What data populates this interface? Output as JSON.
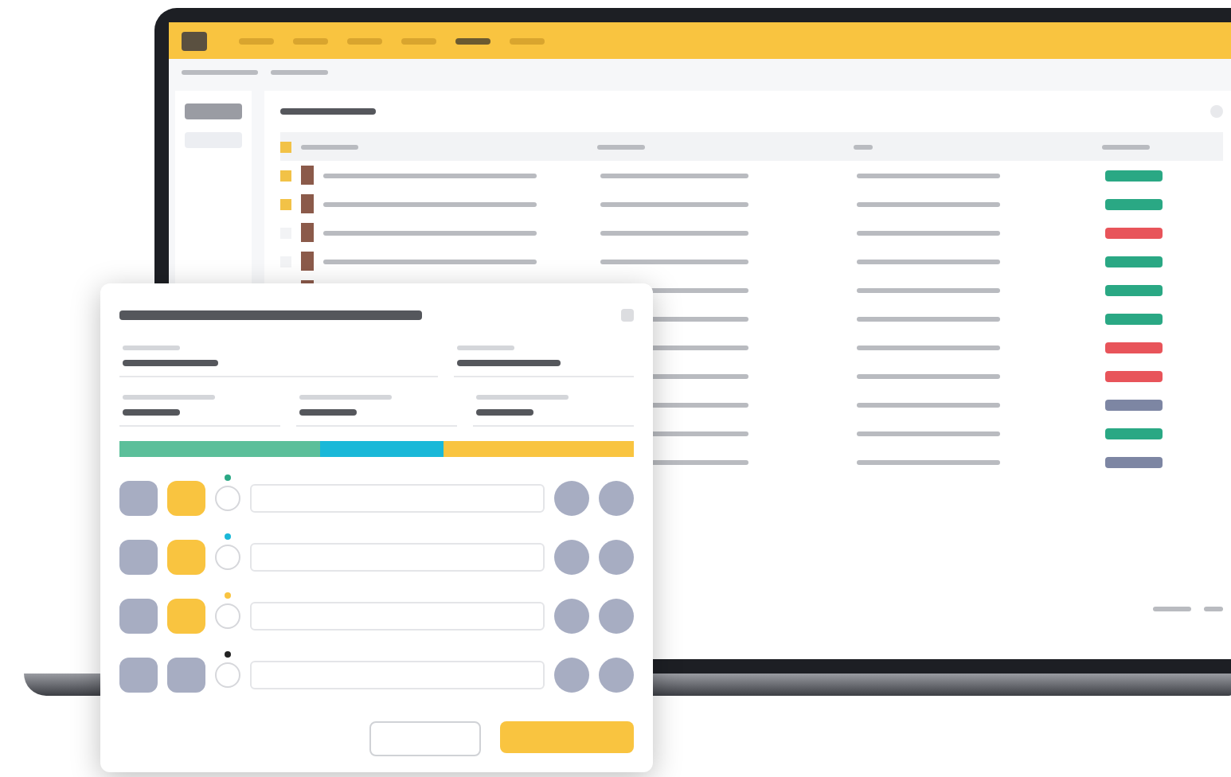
{
  "app": {
    "nav": [
      {
        "selected": false
      },
      {
        "selected": false
      },
      {
        "selected": false
      },
      {
        "selected": false
      },
      {
        "selected": true
      },
      {
        "selected": false
      }
    ],
    "sidebar": [
      {
        "selected": true
      },
      {
        "selected": false
      }
    ],
    "table": {
      "rows": [
        {
          "flagged": true,
          "color": "#2aa884"
        },
        {
          "flagged": true,
          "color": "#2aa884"
        },
        {
          "flagged": false,
          "color": "#e8545a"
        },
        {
          "flagged": false,
          "color": "#2aa884"
        },
        {
          "color": "#2aa884"
        },
        {
          "color": "#2aa884"
        },
        {
          "color": "#e8545a"
        },
        {
          "color": "#e8545a"
        },
        {
          "color": "#7d86a3"
        },
        {
          "color": "#2aa884"
        },
        {
          "color": "#7d86a3"
        }
      ]
    }
  },
  "dialog": {
    "rows": [
      {
        "active": true,
        "color": "#2aa884"
      },
      {
        "active": true,
        "color": "#1ab8d8"
      },
      {
        "active": true,
        "color": "#f9c440"
      },
      {
        "active": false,
        "color": "#222222"
      }
    ]
  }
}
